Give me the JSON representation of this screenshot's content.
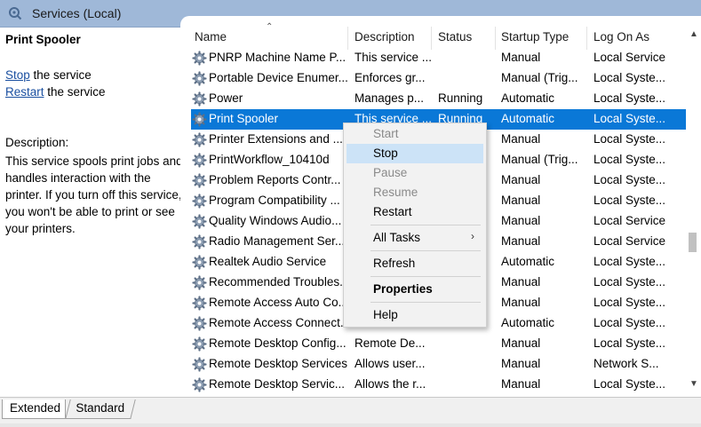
{
  "window": {
    "title": "Services (Local)"
  },
  "left_panel": {
    "service_title": "Print Spooler",
    "stop_link": "Stop",
    "stop_suffix": " the service",
    "restart_link": "Restart",
    "restart_suffix": " the service",
    "description_label": "Description:",
    "description": "This service spools print jobs and handles interaction with the printer.  If you turn off this service, you won't be able to print or see your printers."
  },
  "columns": {
    "name": "Name",
    "description": "Description",
    "status": "Status",
    "startup_type": "Startup Type",
    "log_on_as": "Log On As"
  },
  "rows": [
    {
      "name": "PNRP Machine Name P...",
      "description": "This service ...",
      "status": "",
      "startup": "Manual",
      "logon": "Local Service"
    },
    {
      "name": "Portable Device Enumer...",
      "description": "Enforces gr...",
      "status": "",
      "startup": "Manual (Trig...",
      "logon": "Local Syste..."
    },
    {
      "name": "Power",
      "description": "Manages p...",
      "status": "Running",
      "startup": "Automatic",
      "logon": "Local Syste..."
    },
    {
      "name": "Print Spooler",
      "description": "This service ...",
      "status": "Running",
      "startup": "Automatic",
      "logon": "Local Syste..."
    },
    {
      "name": "Printer Extensions and ...",
      "description": "",
      "status": "",
      "startup": "Manual",
      "logon": "Local Syste..."
    },
    {
      "name": "PrintWorkflow_10410d",
      "description": "",
      "status": "",
      "startup": "Manual (Trig...",
      "logon": "Local Syste..."
    },
    {
      "name": "Problem Reports Contr...",
      "description": "",
      "status": "",
      "startup": "Manual",
      "logon": "Local Syste..."
    },
    {
      "name": "Program Compatibility ...",
      "description": "",
      "status": "",
      "startup": "Manual",
      "logon": "Local Syste..."
    },
    {
      "name": "Quality Windows Audio...",
      "description": "",
      "status": "",
      "startup": "Manual",
      "logon": "Local Service"
    },
    {
      "name": "Radio Management Ser...",
      "description": "",
      "status": "",
      "startup": "Manual",
      "logon": "Local Service"
    },
    {
      "name": "Realtek Audio Service",
      "description": "",
      "status": "",
      "startup": "Automatic",
      "logon": "Local Syste..."
    },
    {
      "name": "Recommended Troubles...",
      "description": "",
      "status": "",
      "startup": "Manual",
      "logon": "Local Syste..."
    },
    {
      "name": "Remote Access Auto Co...",
      "description": "",
      "status": "",
      "startup": "Manual",
      "logon": "Local Syste..."
    },
    {
      "name": "Remote Access Connect...",
      "description": "",
      "status": "",
      "startup": "Automatic",
      "logon": "Local Syste..."
    },
    {
      "name": "Remote Desktop Config...",
      "description": "Remote De...",
      "status": "",
      "startup": "Manual",
      "logon": "Local Syste..."
    },
    {
      "name": "Remote Desktop Services",
      "description": "Allows user...",
      "status": "",
      "startup": "Manual",
      "logon": "Network S..."
    },
    {
      "name": "Remote Desktop Servic...",
      "description": "Allows the r...",
      "status": "",
      "startup": "Manual",
      "logon": "Local Syste..."
    }
  ],
  "selected_row": "Print Spooler",
  "context_menu": {
    "start": "Start",
    "stop": "Stop",
    "pause": "Pause",
    "resume": "Resume",
    "restart": "Restart",
    "all_tasks": "All Tasks",
    "refresh": "Refresh",
    "properties": "Properties",
    "help": "Help"
  },
  "tabs": {
    "extended": "Extended",
    "standard": "Standard"
  },
  "colors": {
    "title_bar": "#9fb8d8",
    "selection": "#0a78d7",
    "menu_hover": "#cce3f7",
    "link": "#1a4fa0"
  },
  "icons": {
    "window": "services-gear-icon",
    "row": "gear-icon",
    "submenu": "chevron-right-icon"
  }
}
